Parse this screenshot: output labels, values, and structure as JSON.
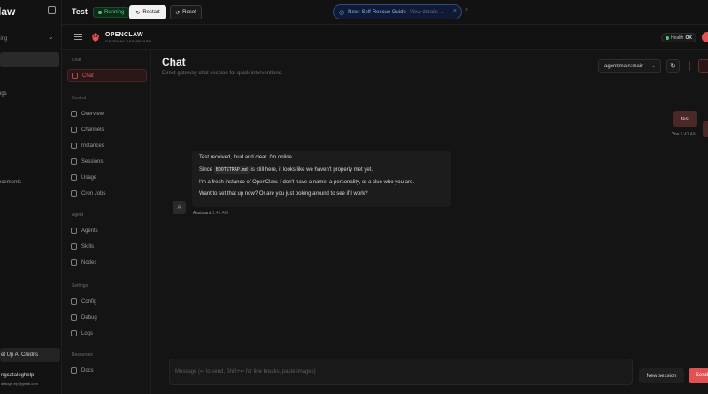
{
  "outer_sidebar": {
    "brand": "law",
    "workspace_status": "ning",
    "items": [
      "ngs",
      "l",
      "t",
      "ncements"
    ],
    "credits_label": "et Up AI Credits",
    "user_name": "ngcataloghelp",
    "user_email": "atalogh elp@gmail.com"
  },
  "topbar": {
    "title": "Test",
    "status": "Running",
    "restart_label": "Restart",
    "reset_label": "Reset",
    "banner_glyph": "◎",
    "banner_text": "New: Self-Rescue Guide",
    "banner_link": "View details →",
    "banner_close": "×",
    "close_glyph": "×"
  },
  "header": {
    "app_name": "OPENCLAW",
    "app_sub": "GATEWAY DASHBOARD",
    "health_label": "Health",
    "health_value": "OK"
  },
  "nav": {
    "groups": {
      "chat": "Chat",
      "control": "Control",
      "agent": "Agent",
      "settings": "Settings",
      "resources": "Resources"
    },
    "items": {
      "chat": "Chat",
      "overview": "Overview",
      "channels": "Channels",
      "instances": "Instances",
      "sessions": "Sessions",
      "usage": "Usage",
      "cron": "Cron Jobs",
      "agents": "Agents",
      "skills": "Skills",
      "nodes": "Nodes",
      "config": "Config",
      "debug": "Debug",
      "logs": "Logs",
      "docs": "Docs"
    }
  },
  "chat": {
    "title": "Chat",
    "subtitle": "Direct gateway chat session for quick interventions.",
    "session_value": "agent:main:main",
    "session_chev": "⌄",
    "refresh_glyph": "↻",
    "user_message": "test",
    "user_sender": "You",
    "user_time": "1:41 AM",
    "assistant_avatar": "A",
    "assistant_lines": {
      "l1": "Test received, loud and clear. I'm online.",
      "l2_pre": "Since",
      "l2_code": "BOOTSTRAP.md",
      "l2_post": "is still here, it looks like we haven't properly met yet.",
      "l3": "I'm a fresh instance of OpenClaw. I don't have a name, a personality, or a clue who you are.",
      "l4": "Want to set that up now? Or are you just poking around to see if I work?"
    },
    "assistant_sender": "Assistant",
    "assistant_time": "1:41 AM",
    "composer_placeholder": "Message (↩ to send, Shift+↩ for line breaks, paste images)",
    "new_session_label": "New session",
    "send_label": "Send"
  },
  "colors": {
    "accent": "#e25252",
    "running": "#3fd37a",
    "banner": "#8fb1ff"
  }
}
